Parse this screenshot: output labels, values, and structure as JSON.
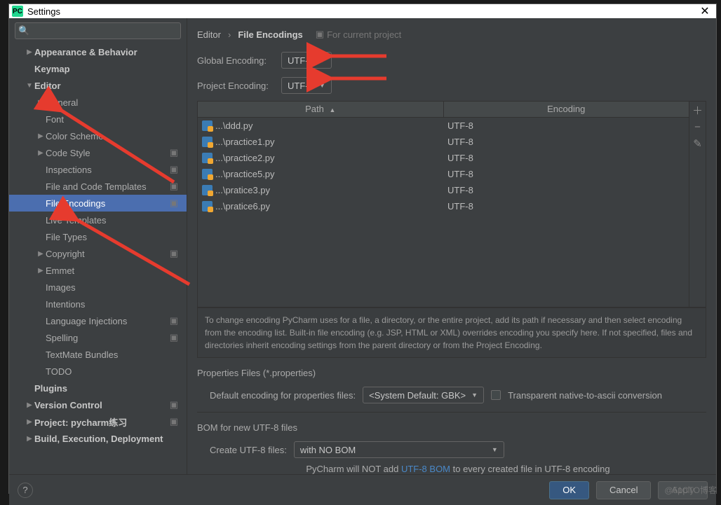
{
  "window": {
    "title": "Settings",
    "appIconText": "PC"
  },
  "search": {
    "placeholder": ""
  },
  "sidebar": {
    "items": [
      {
        "label": "Appearance & Behavior",
        "depth": 0,
        "arrow": "▶",
        "bold": true
      },
      {
        "label": "Keymap",
        "depth": 0,
        "arrow": "",
        "bold": true
      },
      {
        "label": "Editor",
        "depth": 0,
        "arrow": "▼",
        "bold": true
      },
      {
        "label": "General",
        "depth": 1,
        "arrow": "▶"
      },
      {
        "label": "Font",
        "depth": 1,
        "arrow": ""
      },
      {
        "label": "Color Scheme",
        "depth": 1,
        "arrow": "▶"
      },
      {
        "label": "Code Style",
        "depth": 1,
        "arrow": "▶",
        "proj": true
      },
      {
        "label": "Inspections",
        "depth": 1,
        "arrow": "",
        "proj": true
      },
      {
        "label": "File and Code Templates",
        "depth": 1,
        "arrow": "",
        "proj": true
      },
      {
        "label": "File Encodings",
        "depth": 1,
        "arrow": "",
        "proj": true,
        "selected": true
      },
      {
        "label": "Live Templates",
        "depth": 1,
        "arrow": ""
      },
      {
        "label": "File Types",
        "depth": 1,
        "arrow": ""
      },
      {
        "label": "Copyright",
        "depth": 1,
        "arrow": "▶",
        "proj": true
      },
      {
        "label": "Emmet",
        "depth": 1,
        "arrow": "▶"
      },
      {
        "label": "Images",
        "depth": 1,
        "arrow": ""
      },
      {
        "label": "Intentions",
        "depth": 1,
        "arrow": ""
      },
      {
        "label": "Language Injections",
        "depth": 1,
        "arrow": "",
        "proj": true
      },
      {
        "label": "Spelling",
        "depth": 1,
        "arrow": "",
        "proj": true
      },
      {
        "label": "TextMate Bundles",
        "depth": 1,
        "arrow": ""
      },
      {
        "label": "TODO",
        "depth": 1,
        "arrow": ""
      },
      {
        "label": "Plugins",
        "depth": 0,
        "arrow": "",
        "bold": true
      },
      {
        "label": "Version Control",
        "depth": 0,
        "arrow": "▶",
        "bold": true,
        "proj": true
      },
      {
        "label": "Project: pycharm练习",
        "depth": 0,
        "arrow": "▶",
        "bold": true,
        "proj": true
      },
      {
        "label": "Build, Execution, Deployment",
        "depth": 0,
        "arrow": "▶",
        "bold": true
      }
    ]
  },
  "breadcrumb": {
    "root": "Editor",
    "current": "File Encodings",
    "scope": "For current project"
  },
  "global": {
    "label": "Global Encoding:",
    "value": "UTF-8"
  },
  "project": {
    "label": "Project Encoding:",
    "value": "UTF-8"
  },
  "table": {
    "headers": {
      "path": "Path",
      "encoding": "Encoding"
    },
    "rows": [
      {
        "path": "...\\ddd.py",
        "encoding": "UTF-8"
      },
      {
        "path": "...\\practice1.py",
        "encoding": "UTF-8"
      },
      {
        "path": "...\\practice2.py",
        "encoding": "UTF-8"
      },
      {
        "path": "...\\practice5.py",
        "encoding": "UTF-8"
      },
      {
        "path": "...\\pratice3.py",
        "encoding": "UTF-8"
      },
      {
        "path": "...\\pratice6.py",
        "encoding": "UTF-8"
      }
    ]
  },
  "hint": "To change encoding PyCharm uses for a file, a directory, or the entire project, add its path if necessary and then select encoding from the encoding list. Built-in file encoding (e.g. JSP, HTML or XML) overrides encoding you specify here. If not specified, files and directories inherit encoding settings from the parent directory or from the Project Encoding.",
  "props": {
    "section": "Properties Files (*.properties)",
    "defLabel": "Default encoding for properties files:",
    "defValue": "<System Default: GBK>",
    "cbLabel": "Transparent native-to-ascii conversion"
  },
  "bom": {
    "section": "BOM for new UTF-8 files",
    "createLabel": "Create UTF-8 files:",
    "createValue": "with NO BOM",
    "note1": "PyCharm will NOT add ",
    "noteLink": "UTF-8 BOM",
    "note2": " to every created file in UTF-8 encoding"
  },
  "footer": {
    "ok": "OK",
    "cancel": "Cancel",
    "apply": "Apply"
  },
  "watermark": "@51CTO博客"
}
